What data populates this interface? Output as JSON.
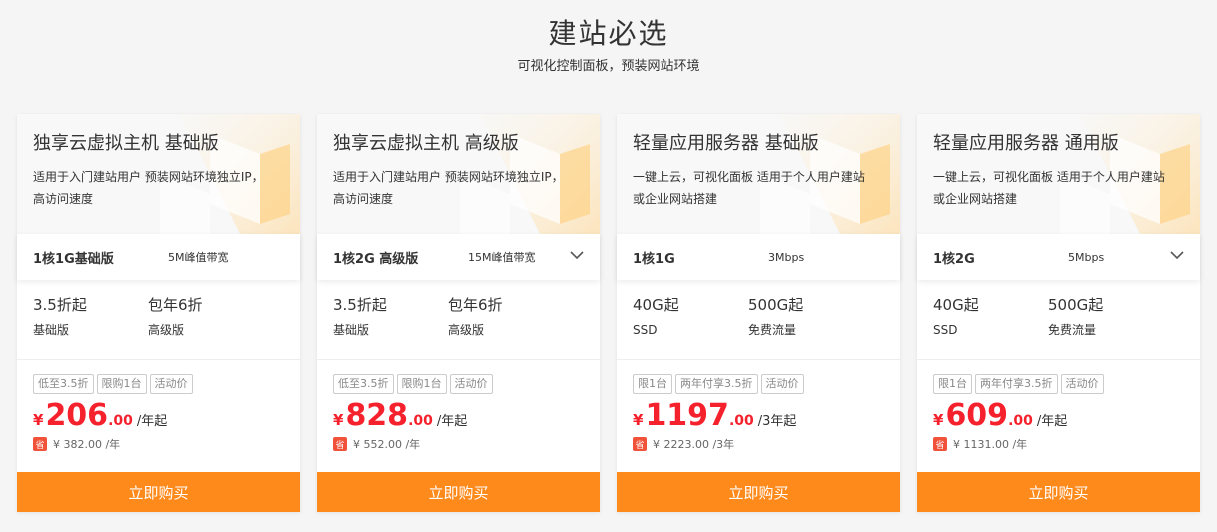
{
  "header": {
    "title": "建站必选",
    "subtitle": "可视化控制面板，预装网站环境"
  },
  "colors": {
    "accent": "#ff8a1c",
    "price": "#f5222d",
    "discount_badge": "#f0533a"
  },
  "cards": [
    {
      "title": "独享云虚拟主机 基础版",
      "desc": "适用于入门建站用户 预装网站环境独立IP，高访问速度",
      "spec_name": "1核1G基础版",
      "bandwidth": "5M峰值带宽",
      "has_dropdown": false,
      "features": [
        {
          "value": "3.5折起",
          "label": "基础版"
        },
        {
          "value": "包年6折",
          "label": "高级版"
        }
      ],
      "tags": [
        "低至3.5折",
        "限购1台",
        "活动价"
      ],
      "currency": "¥",
      "price_int": "206",
      "price_dec": ".00",
      "price_unit": "/年起",
      "discount_icon": "省",
      "orig_price": "¥ 382.00 /年",
      "buy_label": "立即购买"
    },
    {
      "title": "独享云虚拟主机 高级版",
      "desc": "适用于入门建站用户 预装网站环境独立IP，高访问速度",
      "spec_name": "1核2G 高级版",
      "bandwidth": "15M峰值带宽",
      "has_dropdown": true,
      "features": [
        {
          "value": "3.5折起",
          "label": "基础版"
        },
        {
          "value": "包年6折",
          "label": "高级版"
        }
      ],
      "tags": [
        "低至3.5折",
        "限购1台",
        "活动价"
      ],
      "currency": "¥",
      "price_int": "828",
      "price_dec": ".00",
      "price_unit": "/年起",
      "discount_icon": "省",
      "orig_price": "¥ 552.00 /年",
      "buy_label": "立即购买"
    },
    {
      "title": "轻量应用服务器 基础版",
      "desc": "一键上云，可视化面板 适用于个人用户建站或企业网站搭建",
      "spec_name": "1核1G",
      "bandwidth": "3Mbps",
      "has_dropdown": false,
      "features": [
        {
          "value": "40G起",
          "label": "SSD"
        },
        {
          "value": "500G起",
          "label": "免费流量"
        }
      ],
      "tags": [
        "限1台",
        "两年付享3.5折",
        "活动价"
      ],
      "currency": "¥",
      "price_int": "1197",
      "price_dec": ".00",
      "price_unit": "/3年起",
      "discount_icon": "省",
      "orig_price": "¥ 2223.00 /3年",
      "buy_label": "立即购买"
    },
    {
      "title": "轻量应用服务器 通用版",
      "desc": "一键上云，可视化面板 适用于个人用户建站或企业网站搭建",
      "spec_name": "1核2G",
      "bandwidth": "5Mbps",
      "has_dropdown": true,
      "features": [
        {
          "value": "40G起",
          "label": "SSD"
        },
        {
          "value": "500G起",
          "label": "免费流量"
        }
      ],
      "tags": [
        "限1台",
        "两年付享3.5折",
        "活动价"
      ],
      "currency": "¥",
      "price_int": "609",
      "price_dec": ".00",
      "price_unit": "/年起",
      "discount_icon": "省",
      "orig_price": "¥ 1131.00 /年",
      "buy_label": "立即购买"
    }
  ]
}
